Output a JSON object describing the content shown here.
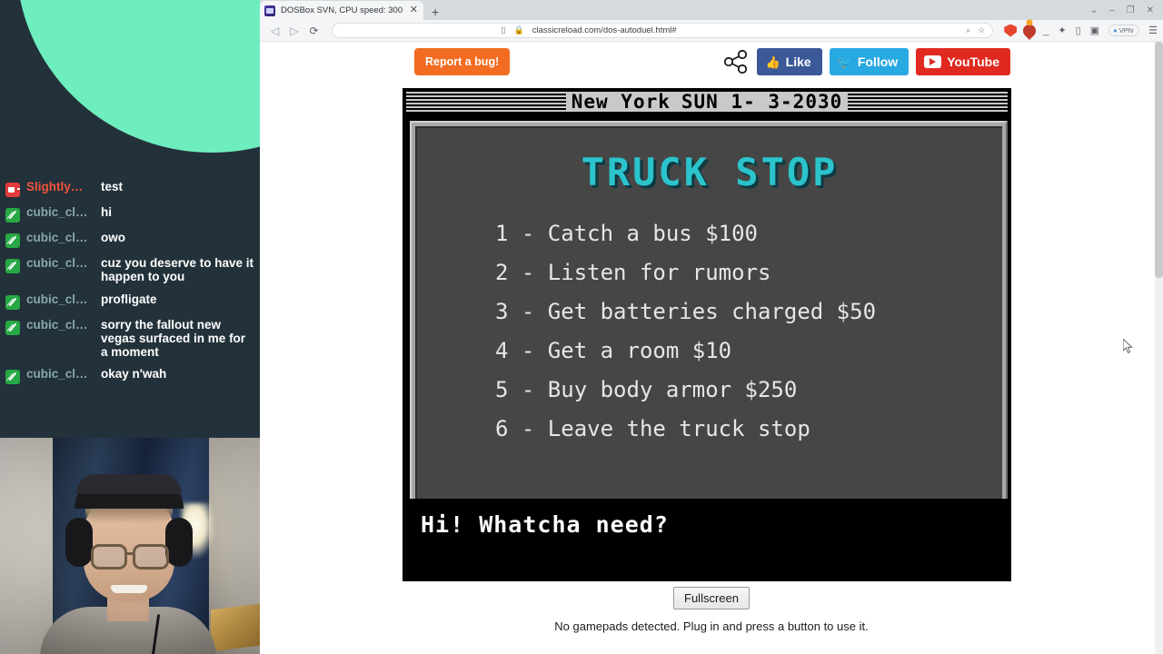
{
  "stream": {
    "chat": [
      {
        "badge": "broadcaster-badge",
        "user": "Slightly…",
        "message": "test",
        "role": "broadcaster"
      },
      {
        "badge": "mod-badge",
        "user": "cubic_cl…",
        "message": "hi",
        "role": "mod"
      },
      {
        "badge": "mod-badge",
        "user": "cubic_cl…",
        "message": "owo",
        "role": "mod"
      },
      {
        "badge": "mod-badge",
        "user": "cubic_cl…",
        "message": "cuz you deserve to have it happen to you",
        "role": "mod"
      },
      {
        "badge": "mod-badge",
        "user": "cubic_cl…",
        "message": "profligate",
        "role": "mod"
      },
      {
        "badge": "mod-badge",
        "user": "cubic_cl…",
        "message": "sorry the fallout new vegas surfaced in me for a moment",
        "role": "mod"
      },
      {
        "badge": "mod-badge",
        "user": "cubic_cl…",
        "message": "okay n'wah",
        "role": "mod"
      }
    ],
    "colors": {
      "background": "#23313a",
      "blob": "#6eeebe",
      "broadcaster_name": "#f0553c",
      "mod_name": "#86a8a8",
      "message": "#ffffff"
    }
  },
  "browser": {
    "tab": {
      "title": "DOSBox SVN, CPU speed: 300",
      "close_label": "✕"
    },
    "new_tab_label": "+",
    "window_controls": {
      "collapse": "⌄",
      "minimize": "–",
      "maximize": "❐",
      "close": "✕"
    },
    "nav": {
      "back": "◁",
      "forward": "▷",
      "reload": "⟳"
    },
    "omnibox": {
      "bookmark_glyph": "▯",
      "lock_glyph": "🔒",
      "url": "classicreload.com/dos-autoduel.html#",
      "zoom_glyph": "⌕",
      "star_glyph": "☆"
    },
    "toolbar_right": {
      "underscore": "_",
      "puzzle_glyph": "✦",
      "sidepanel_glyph": "▯",
      "profile_glyph": "▣",
      "vpn_label": "VPN",
      "vpn_dot": "●",
      "menu_glyph": "☰"
    }
  },
  "page": {
    "report_button": "Report a bug!",
    "social": {
      "share_icon": "share-icon",
      "like_label": "Like",
      "like_glyph": "👍",
      "follow_label": "Follow",
      "follow_glyph": "🐦",
      "youtube_label": "YouTube"
    },
    "fullscreen_button": "Fullscreen",
    "gamepad_note": "No gamepads detected. Plug in and press a button to use it."
  },
  "game": {
    "titlebar": {
      "location": "New York",
      "date": "SUN 1- 3-2030"
    },
    "heading": "TRUCK STOP",
    "menu": [
      "1 - Catch a bus $100",
      "2 - Listen for rumors",
      "3 - Get batteries charged $50",
      "4 - Get a room $10",
      "5 - Buy body armor $250",
      "6 - Leave the truck stop"
    ],
    "console_text": "Hi! Whatcha need?",
    "colors": {
      "heading": "#2bc4cc",
      "panel": "#464646",
      "frame": "#a8a8a8",
      "console_bg": "#000000",
      "text": "#e6e6e6"
    }
  }
}
